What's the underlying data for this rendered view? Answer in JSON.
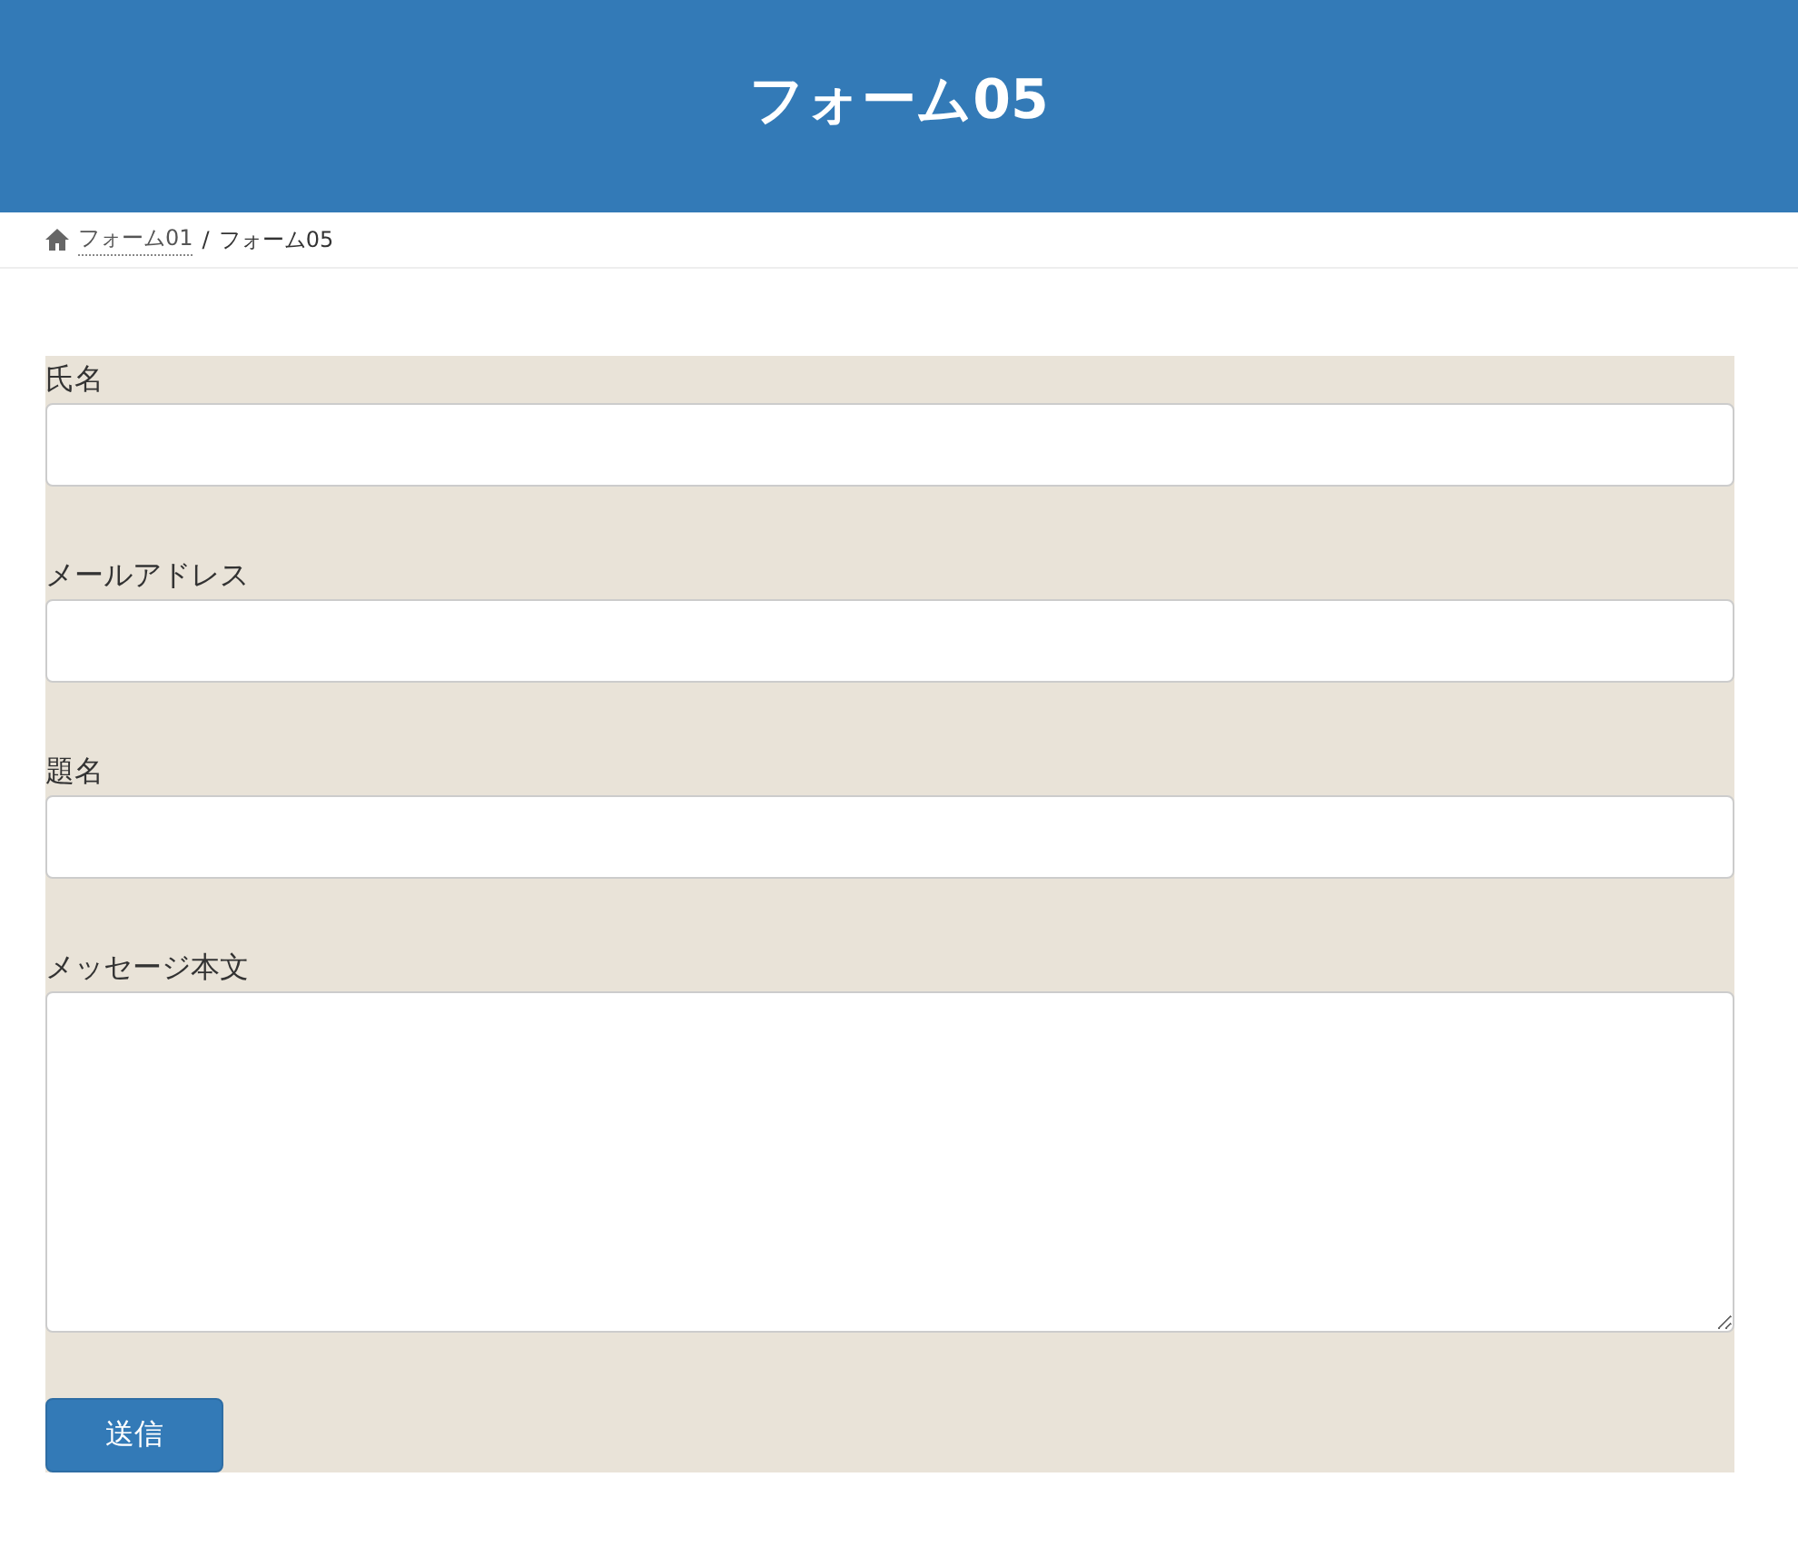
{
  "header": {
    "title": "フォーム05"
  },
  "breadcrumb": [
    {
      "label": "フォーム01",
      "link": true
    },
    {
      "label": "フォーム05",
      "link": false
    }
  ],
  "breadcrumb_separator": "/",
  "form": {
    "fields": [
      {
        "label": "氏名",
        "kind": "text"
      },
      {
        "label": "メールアドレス",
        "kind": "text"
      },
      {
        "label": "題名",
        "kind": "text"
      },
      {
        "label": "メッセージ本文",
        "kind": "textarea"
      }
    ],
    "submit": "送信"
  }
}
